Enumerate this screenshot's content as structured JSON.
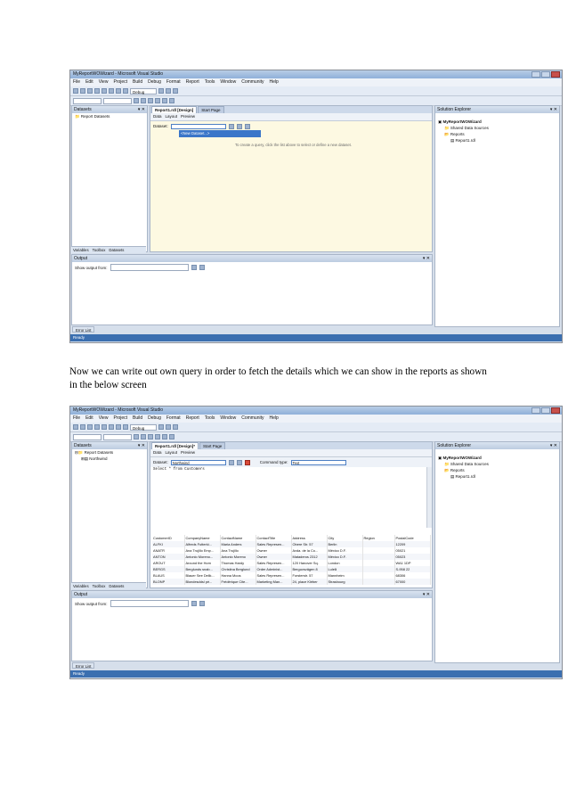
{
  "caption": "Now we can write out own query in order to fetch the details which we can show in the reports as shown in the below screen",
  "window": {
    "title": "MyReportWOWizard - Microsoft Visual Studio",
    "menu": [
      "File",
      "Edit",
      "View",
      "Project",
      "Build",
      "Debug",
      "Format",
      "Report",
      "Tools",
      "Window",
      "Community",
      "Help"
    ],
    "config": "Debug",
    "status": "Ready"
  },
  "panes": {
    "datasets_title": "Datasets",
    "report_datasets": "Report Datasets",
    "northwind": "Northwind",
    "bottom_tabs": [
      "Variables",
      "Toolbox",
      "Datasets"
    ],
    "output_title": "Output",
    "show_output_from": "Show output from:",
    "error_list": "Error List",
    "solution_title": "Solution Explorer",
    "solution_tree": [
      "MyReportWOWizard",
      "Shared Data Sources",
      "Reports",
      "Report1.rdl"
    ]
  },
  "designer": {
    "doc_tab": "Report1.rdl [Design]",
    "doc_tab_modified": "Report1.rdl [Design]*",
    "start_tab": "Start Page",
    "subtabs": [
      "Data",
      "Layout",
      "Preview"
    ],
    "dataset_label": "Dataset:",
    "new_dataset": "<New Dataset...>",
    "hint": "To create a query, click the list above to select or define a new dataset.",
    "dataset_value2": "Northwind",
    "command_type_label": "Command type:",
    "command_type_value": "Text",
    "query": "Select * from Customers"
  },
  "grid": {
    "columns": [
      "CustomerID",
      "CompanyName",
      "ContactName",
      "ContactTitle",
      "Address",
      "City",
      "Region",
      "PostalCode"
    ],
    "rows": [
      [
        "ALFKI",
        "Alfreds Futterki...",
        "Maria Anders",
        "Sales Represen...",
        "Obere Str. 57",
        "Berlin",
        "",
        "12209"
      ],
      [
        "ANATR",
        "Ana Trujillo Emp...",
        "Ana Trujillo",
        "Owner",
        "Avda. de la Co...",
        "México D.F.",
        "",
        "05021"
      ],
      [
        "ANTON",
        "Antonio Moreno...",
        "Antonio Moreno",
        "Owner",
        "Mataderos 2312",
        "México D.F.",
        "",
        "05023"
      ],
      [
        "AROUT",
        "Around the Horn",
        "Thomas Hardy",
        "Sales Represen...",
        "120 Hanover Sq.",
        "London",
        "",
        "WA1 1DP"
      ],
      [
        "BERGS",
        "Berglunds snab...",
        "Christina Berglund",
        "Order Administ...",
        "Berguvsvägen 8",
        "Luleå",
        "",
        "S-958 22"
      ],
      [
        "BLAUS",
        "Blauer See Delik...",
        "Hanna Moos",
        "Sales Represen...",
        "Forsterstr. 57",
        "Mannheim",
        "",
        "68306"
      ],
      [
        "BLONP",
        "Blondesddsl pè...",
        "Frédérique Cite...",
        "Marketing Man...",
        "24, place Kléber",
        "Strasbourg",
        "",
        "67000"
      ]
    ]
  }
}
